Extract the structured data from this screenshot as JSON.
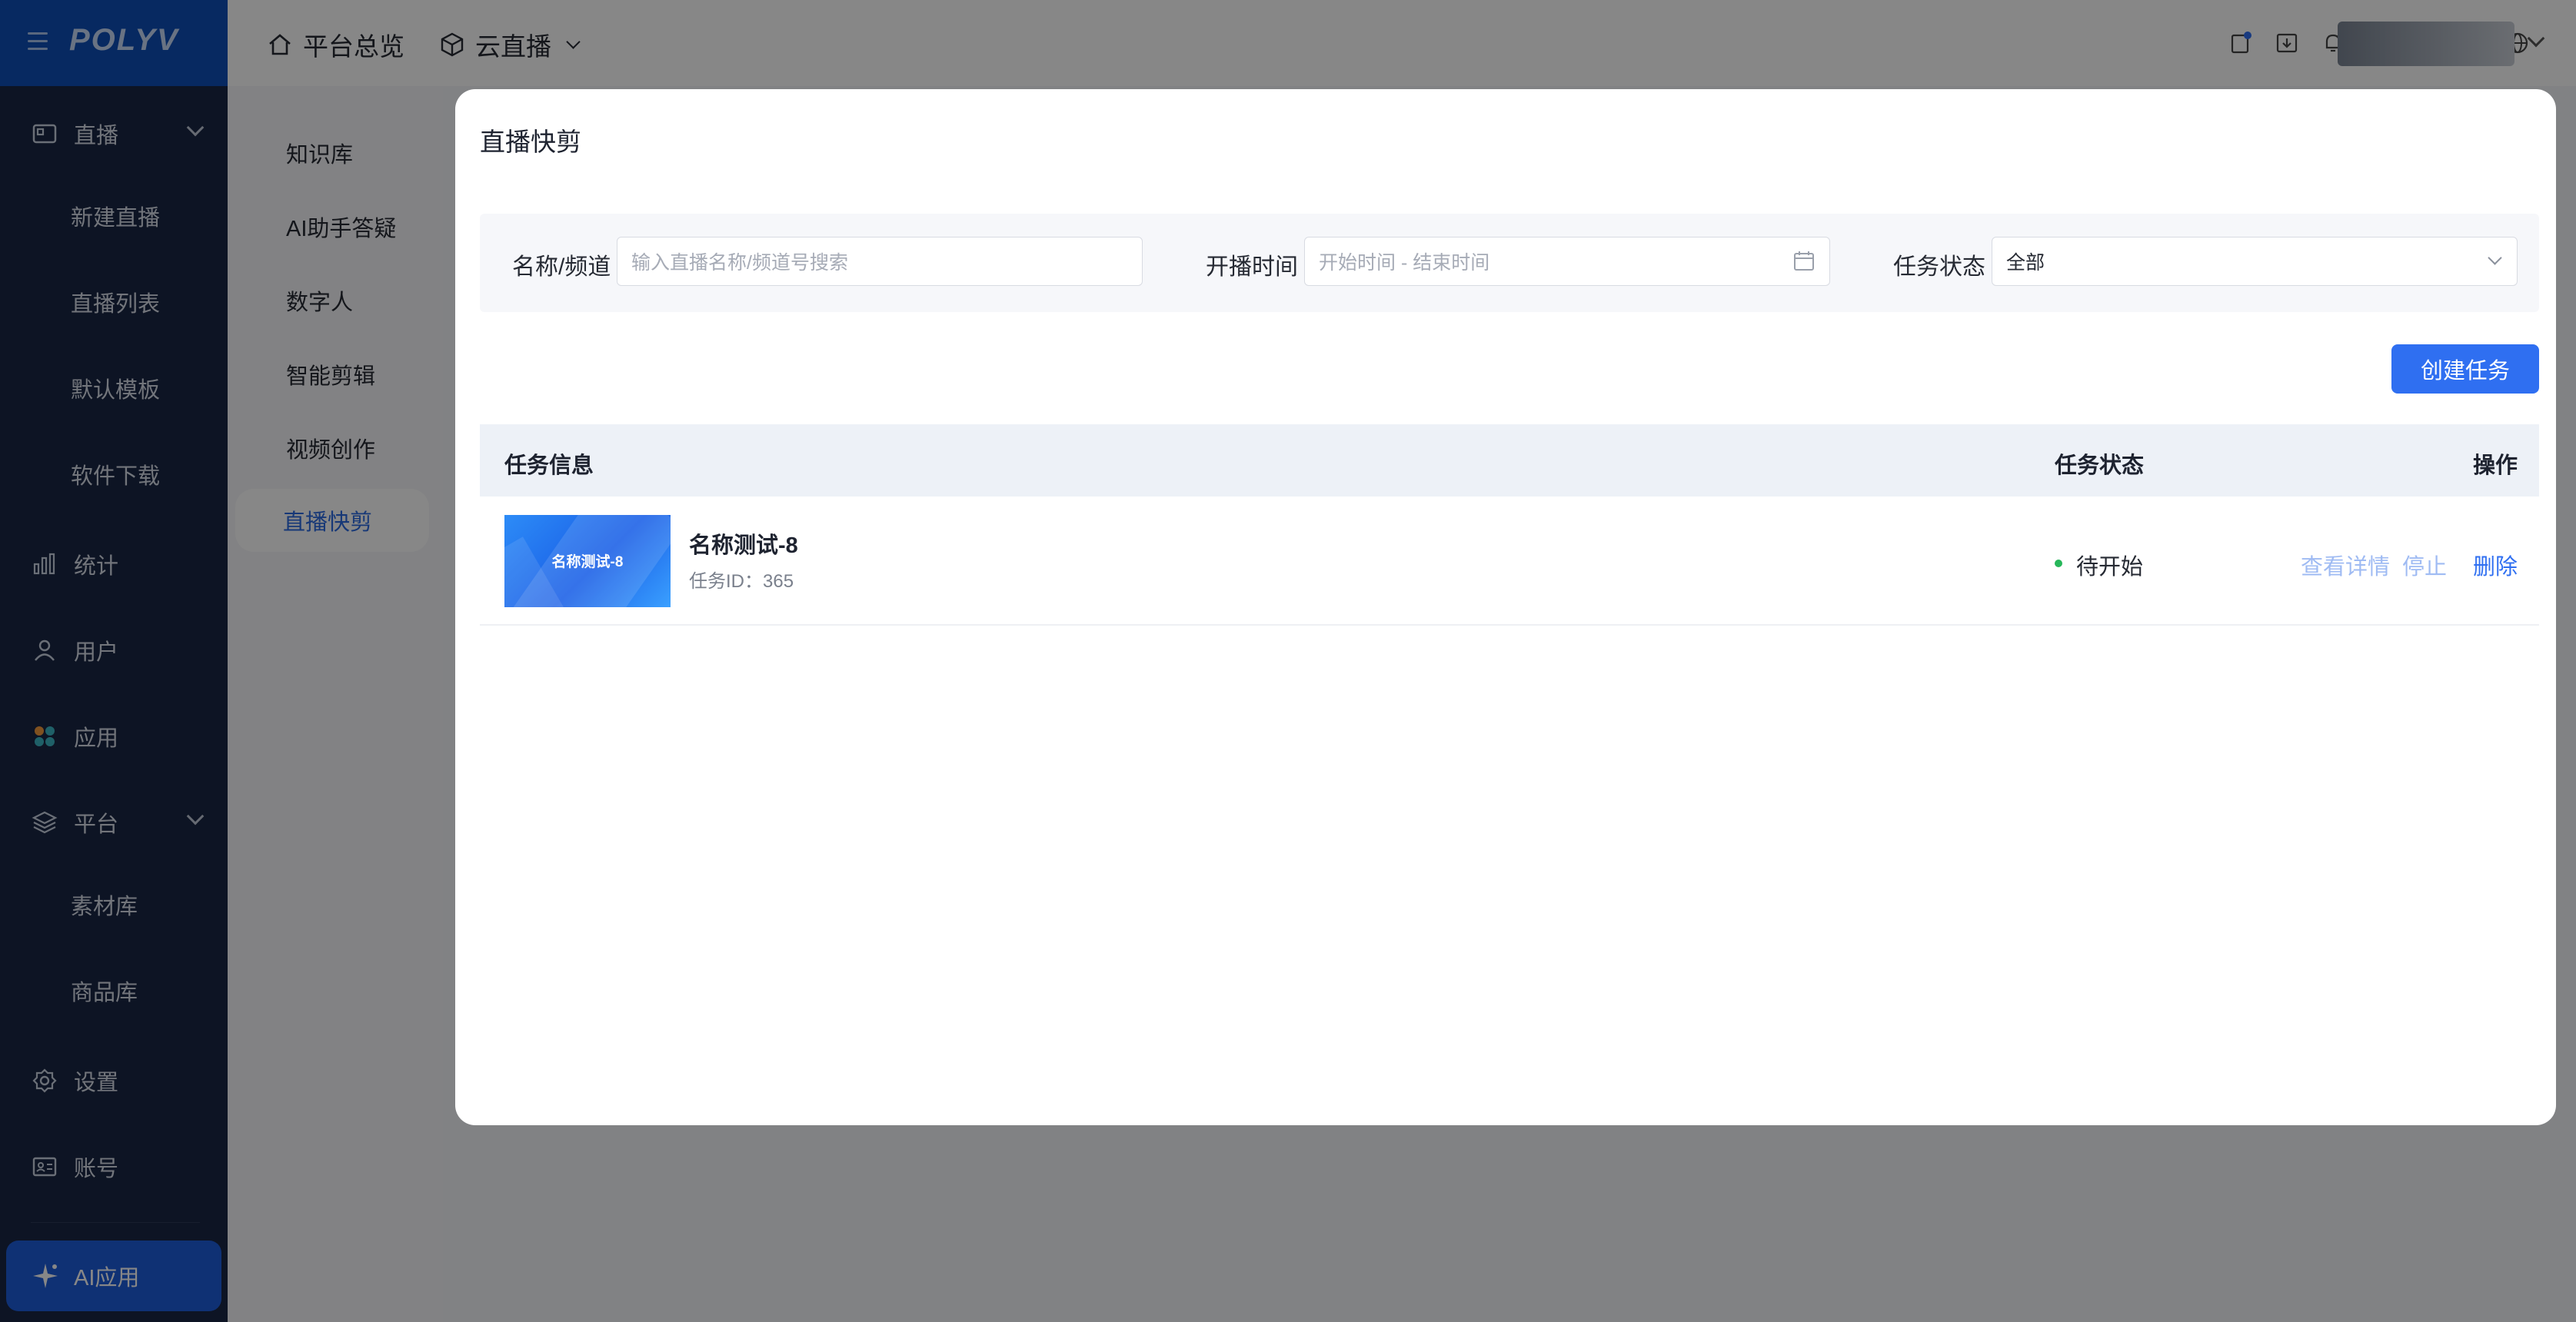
{
  "brand": {
    "logo": "POLYV"
  },
  "sidebar": {
    "items": [
      {
        "label": "直播",
        "icon": "live-icon",
        "expandable": true
      },
      {
        "label": "新建直播",
        "sub": true
      },
      {
        "label": "直播列表",
        "sub": true
      },
      {
        "label": "默认模板",
        "sub": true
      },
      {
        "label": "软件下载",
        "sub": true
      },
      {
        "label": "统计",
        "icon": "stats-icon"
      },
      {
        "label": "用户",
        "icon": "user-icon"
      },
      {
        "label": "应用",
        "icon": "apps-icon"
      },
      {
        "label": "平台",
        "icon": "layers-icon",
        "expandable": true
      },
      {
        "label": "素材库",
        "sub": true
      },
      {
        "label": "商品库",
        "sub": true
      },
      {
        "label": "设置",
        "icon": "settings-icon"
      },
      {
        "label": "账号",
        "icon": "account-icon"
      }
    ],
    "ai_button": "AI应用"
  },
  "subnav": {
    "items": [
      "知识库",
      "AI助手答疑",
      "数字人",
      "智能剪辑",
      "视频创作",
      "直播快剪"
    ],
    "active": "直播快剪"
  },
  "header": {
    "home": "平台总览",
    "product": "云直播"
  },
  "modal": {
    "title": "直播快剪",
    "filters": {
      "name_label": "名称/频道",
      "name_placeholder": "输入直播名称/频道号搜索",
      "time_label": "开播时间",
      "time_placeholder": "开始时间 - 结束时间",
      "status_label": "任务状态",
      "status_value": "全部"
    },
    "create_button": "创建任务",
    "table": {
      "headers": [
        "任务信息",
        "任务状态",
        "操作"
      ],
      "rows": [
        {
          "thumb_text": "名称测试-8",
          "name": "名称测试-8",
          "id_text": "任务ID：365",
          "status": "待开始",
          "actions": [
            "查看详情",
            "停止",
            "删除"
          ]
        }
      ]
    }
  },
  "colors": {
    "accent": "#2f6ff1",
    "sidebar_bg": "#1a2744",
    "status_ok": "#27b75a"
  }
}
